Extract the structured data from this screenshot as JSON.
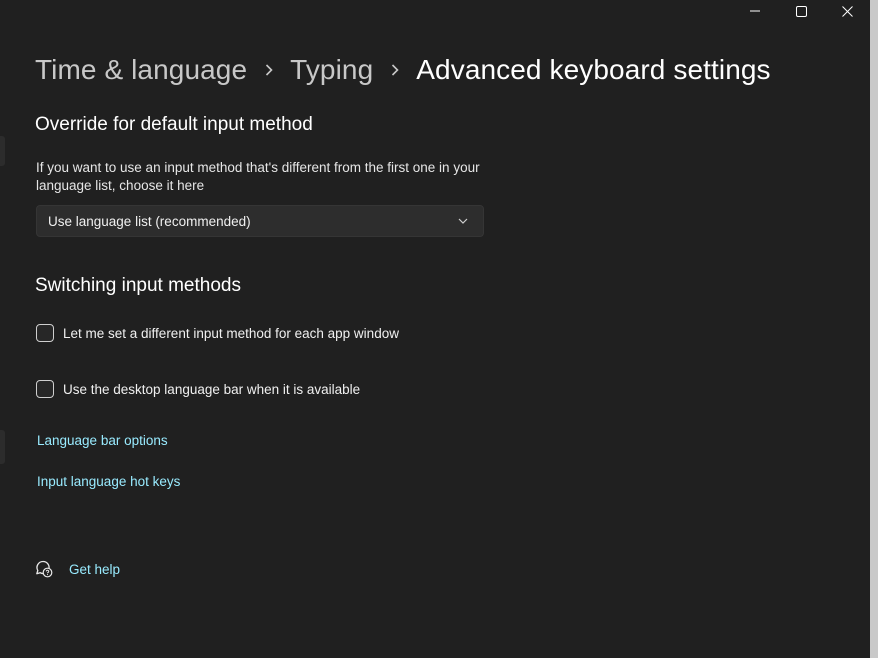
{
  "breadcrumb": {
    "items": [
      "Time & language",
      "Typing"
    ],
    "current": "Advanced keyboard settings"
  },
  "override_section": {
    "title": "Override for default input method",
    "description": "If you want to use an input method that's different from the first one in your language list, choose it here",
    "dropdown_value": "Use language list (recommended)"
  },
  "switching_section": {
    "title": "Switching input methods",
    "checkboxes": [
      {
        "label": "Let me set a different input method for each app window",
        "checked": false
      },
      {
        "label": "Use the desktop language bar when it is available",
        "checked": false
      }
    ],
    "links": [
      "Language bar options",
      "Input language hot keys"
    ]
  },
  "help": {
    "label": "Get help"
  },
  "colors": {
    "background": "#202020",
    "link": "#99ebff",
    "dropdown_bg": "#2d2d2d"
  }
}
